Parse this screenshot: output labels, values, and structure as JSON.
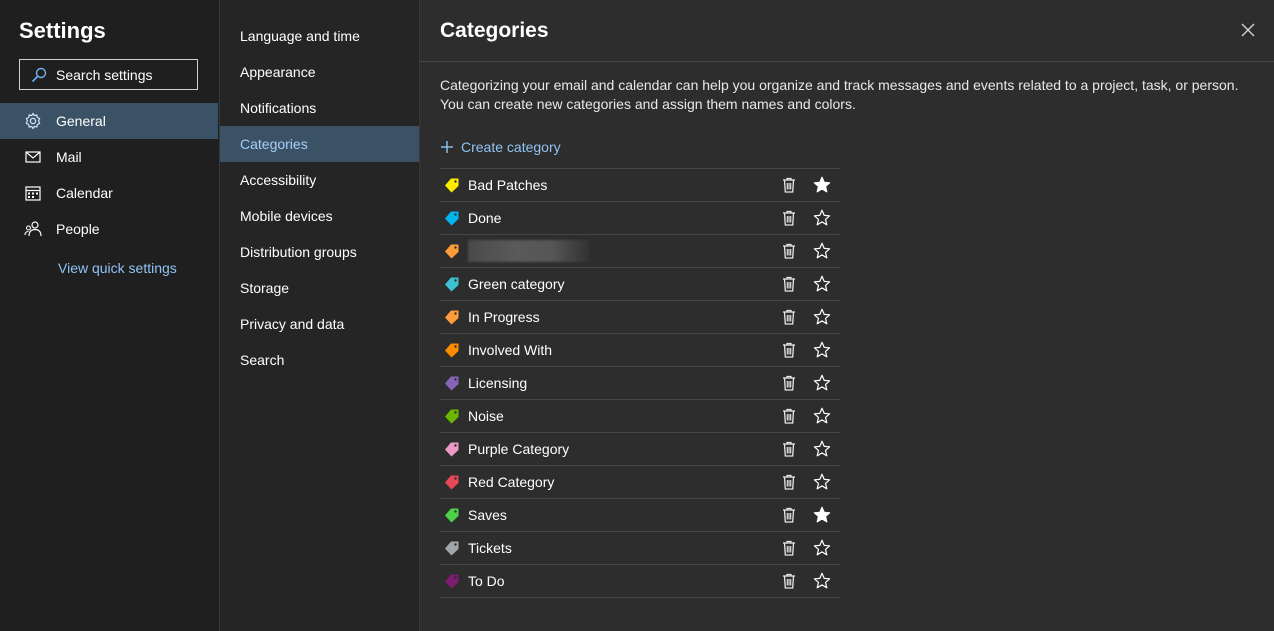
{
  "left": {
    "title": "Settings",
    "search_placeholder": "Search settings",
    "items": [
      {
        "label": "General",
        "icon": "gear-icon",
        "active": true
      },
      {
        "label": "Mail",
        "icon": "mail-icon"
      },
      {
        "label": "Calendar",
        "icon": "calendar-icon"
      },
      {
        "label": "People",
        "icon": "people-icon"
      }
    ],
    "quick_link": "View quick settings"
  },
  "subnav": {
    "items": [
      {
        "label": "Language and time"
      },
      {
        "label": "Appearance"
      },
      {
        "label": "Notifications"
      },
      {
        "label": "Categories",
        "active": true
      },
      {
        "label": "Accessibility"
      },
      {
        "label": "Mobile devices"
      },
      {
        "label": "Distribution groups"
      },
      {
        "label": "Storage"
      },
      {
        "label": "Privacy and data"
      },
      {
        "label": "Search"
      }
    ]
  },
  "main": {
    "title": "Categories",
    "description": "Categorizing your email and calendar can help you organize and track messages and events related to a project, task, or person. You can create new categories and assign them names and colors.",
    "create_label": "Create category",
    "categories": [
      {
        "name": "Bad Patches",
        "color": "#ffeb00",
        "favorite": true
      },
      {
        "name": "Done",
        "color": "#00b4f0",
        "favorite": false
      },
      {
        "name": "",
        "color": "#ff9c3a",
        "favorite": false,
        "redacted": true
      },
      {
        "name": "Green category",
        "color": "#3ec1d3",
        "favorite": false
      },
      {
        "name": "In Progress",
        "color": "#ff9c3a",
        "favorite": false
      },
      {
        "name": "Involved With",
        "color": "#ff8c00",
        "favorite": false
      },
      {
        "name": "Licensing",
        "color": "#8764b8",
        "favorite": false
      },
      {
        "name": "Noise",
        "color": "#6bb700",
        "favorite": false
      },
      {
        "name": "Purple Category",
        "color": "#ef9ac6",
        "favorite": false
      },
      {
        "name": "Red Category",
        "color": "#e74856",
        "favorite": false
      },
      {
        "name": "Saves",
        "color": "#4cd34a",
        "favorite": true
      },
      {
        "name": "Tickets",
        "color": "#a0a6ab",
        "favorite": false
      },
      {
        "name": "To Do",
        "color": "#7a1c6f",
        "favorite": false
      }
    ]
  }
}
